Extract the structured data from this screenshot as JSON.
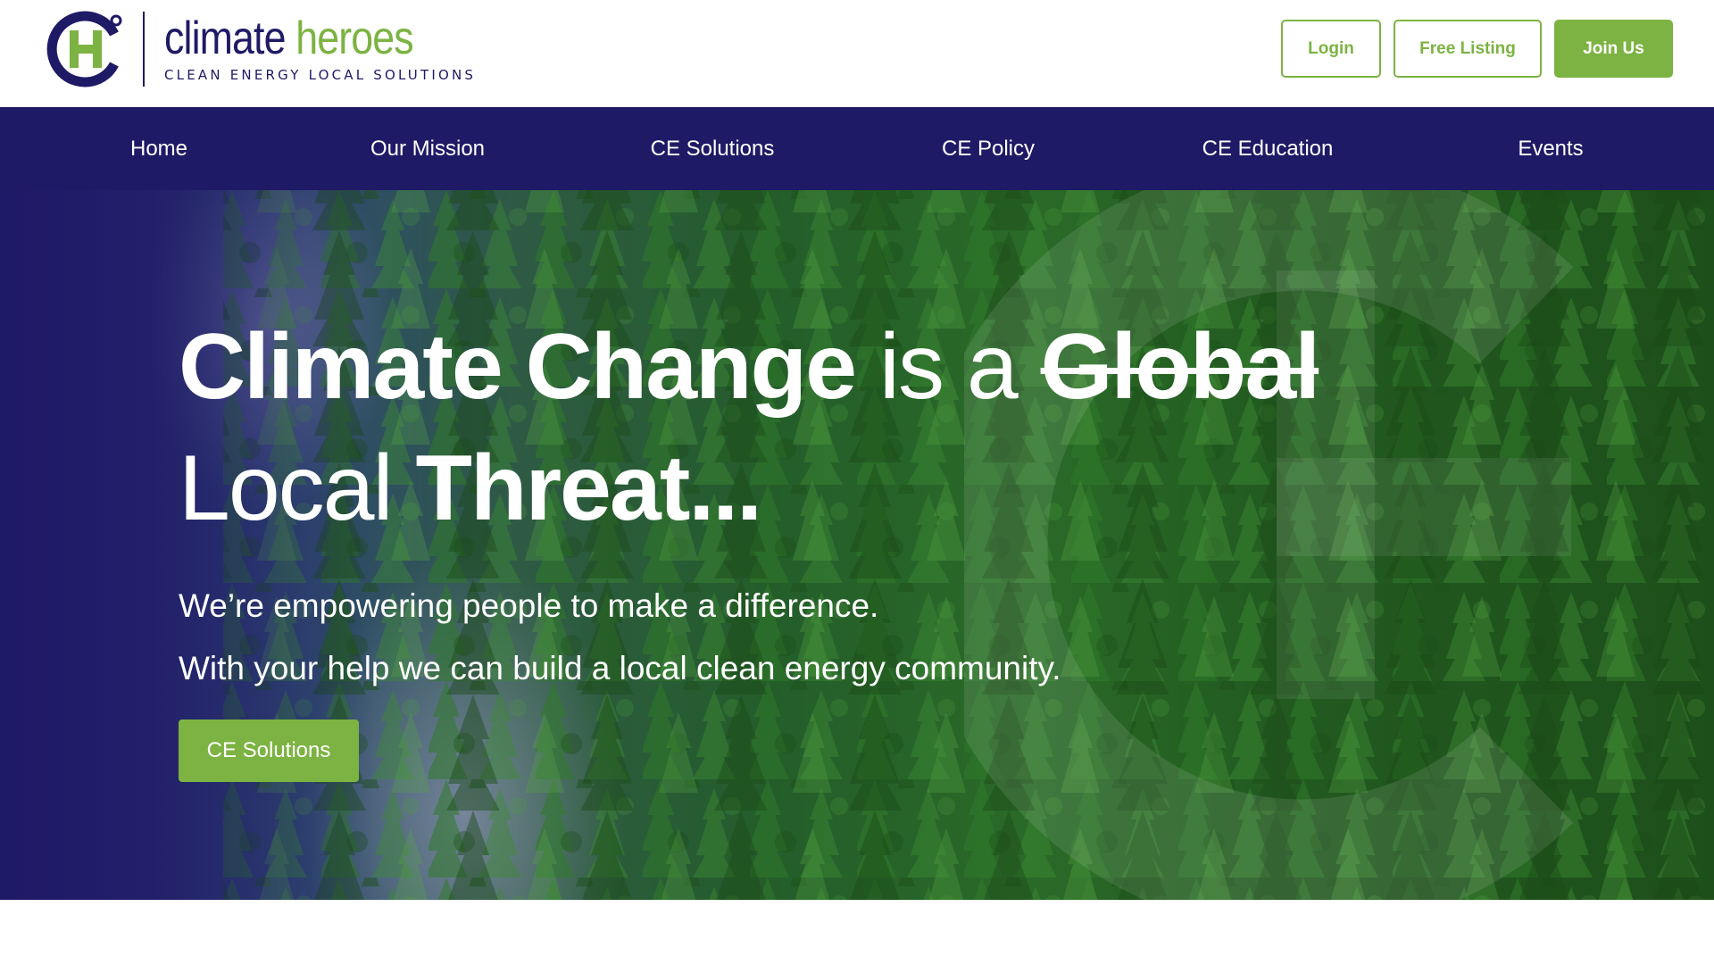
{
  "brand": {
    "name_part1": "climate",
    "name_part2": "heroes",
    "tagline": "CLEAN ENERGY LOCAL SOLUTIONS",
    "icon": "ch-logo-icon",
    "colors": {
      "navy": "#1f1a66",
      "green": "#7cb342"
    }
  },
  "header": {
    "login_label": "Login",
    "free_listing_label": "Free Listing",
    "join_label": "Join Us"
  },
  "nav": {
    "items": [
      {
        "label": "Home"
      },
      {
        "label": "Our Mission"
      },
      {
        "label": "CE Solutions"
      },
      {
        "label": "CE Policy"
      },
      {
        "label": "CE Education"
      },
      {
        "label": "Events"
      }
    ]
  },
  "hero": {
    "headline": {
      "w1": "Climate Change",
      "w2": " is a ",
      "w3": "Global",
      "w4": "Local",
      "w5": " Threat..."
    },
    "sub1": "We’re empowering people to make a difference.",
    "sub2": "With your help we can build a local clean energy community.",
    "button_label": "CE Solutions"
  }
}
